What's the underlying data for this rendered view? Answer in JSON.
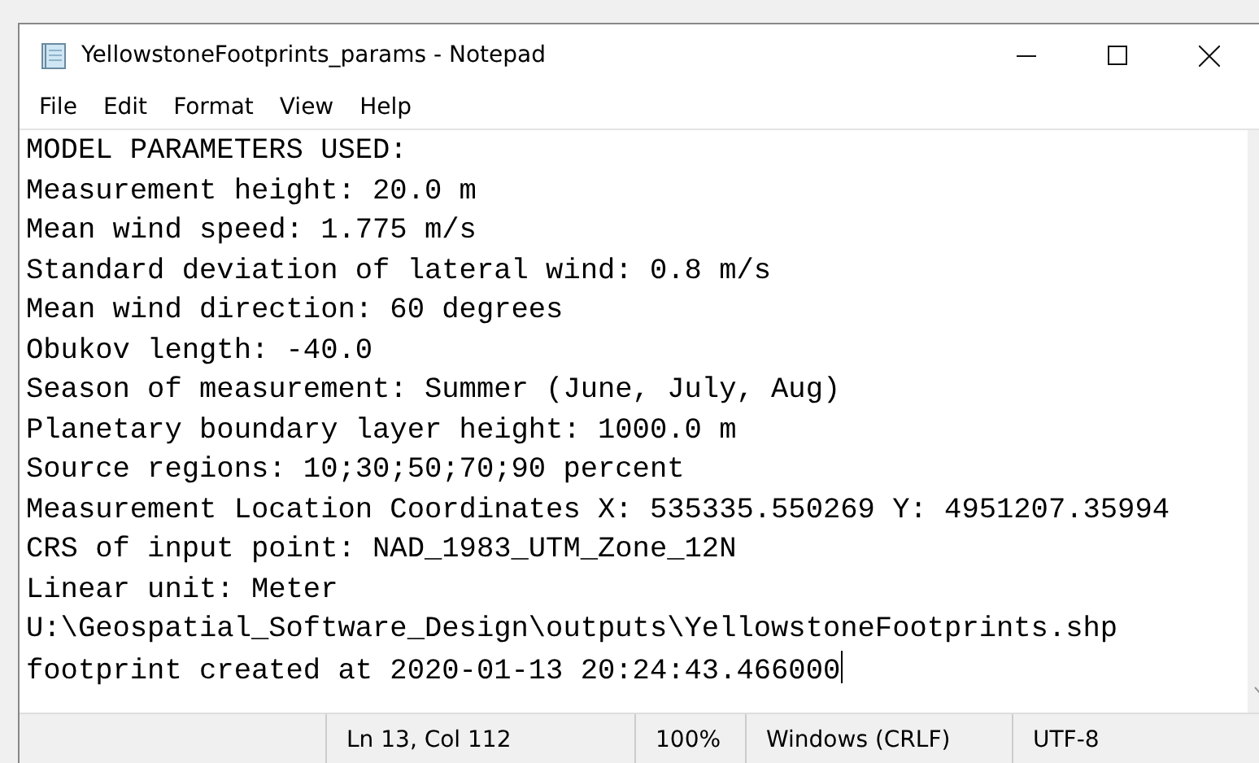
{
  "window": {
    "title": "YellowstoneFootprints_params - Notepad"
  },
  "menu": [
    "File",
    "Edit",
    "Format",
    "View",
    "Help"
  ],
  "editor": {
    "lines": [
      "MODEL PARAMETERS USED:",
      "Measurement height: 20.0 m",
      "Mean wind speed: 1.775 m/s",
      "Standard deviation of lateral wind: 0.8 m/s",
      "Mean wind direction: 60 degrees",
      "Obukov length: -40.0",
      "Season of measurement: Summer (June, July, Aug)",
      "Planetary boundary layer height: 1000.0 m",
      "Source regions: 10;30;50;70;90 percent",
      "Measurement Location Coordinates X: 535335.550269 Y: 4951207.35994",
      "CRS of input point: NAD_1983_UTM_Zone_12N",
      "Linear unit: Meter",
      "U:\\Geospatial_Software_Design\\outputs\\YellowstoneFootprints.shp",
      "footprint created at 2020-01-13 20:24:43.466000"
    ]
  },
  "status_bar": [
    "Ln 13, Col 112",
    "100%",
    "Windows (CRLF)",
    "UTF-8"
  ]
}
